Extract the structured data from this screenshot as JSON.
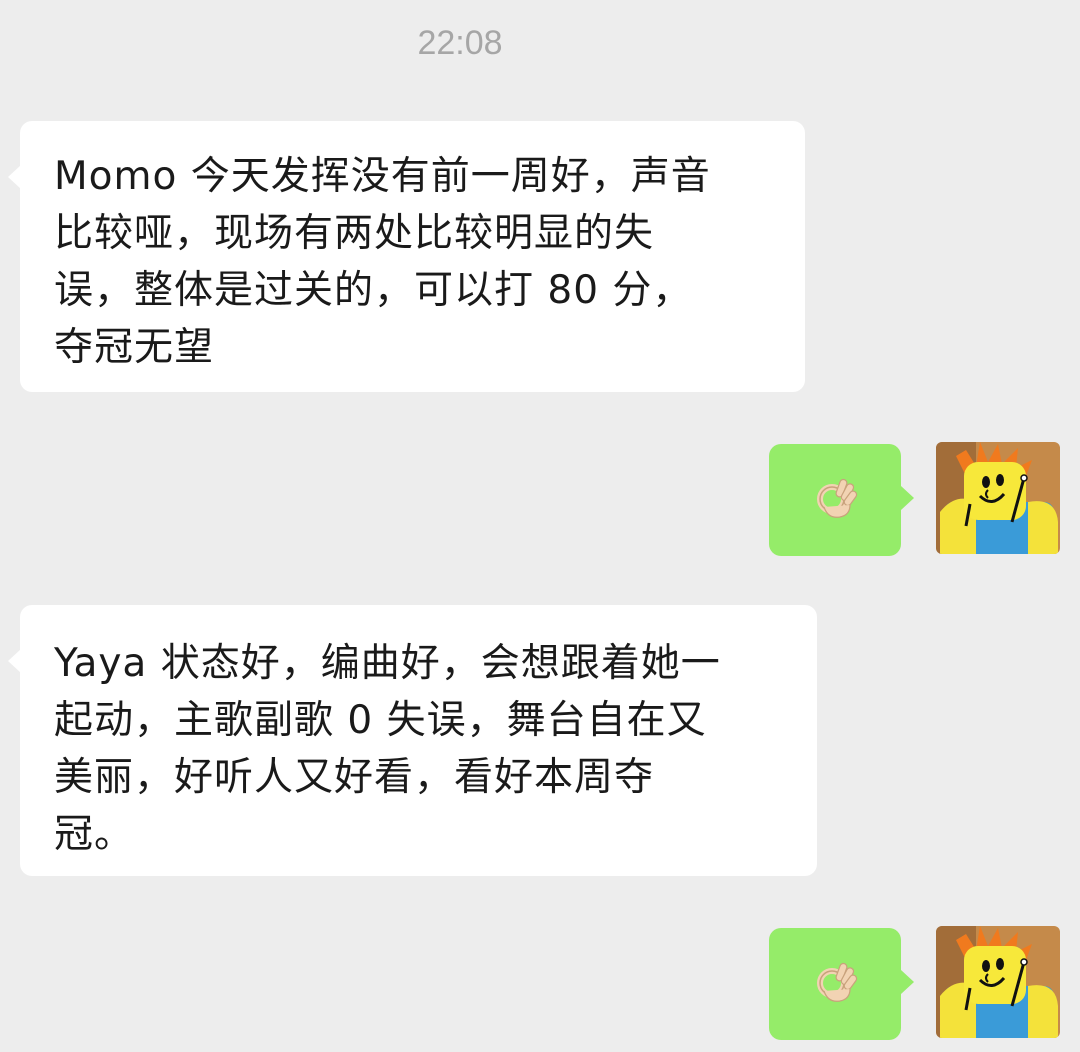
{
  "chat": {
    "timestamp": "22:08",
    "messages": [
      {
        "sender": "other",
        "lines": [
          "Momo 今天发挥没有前一周好，声音",
          "比较哑，现场有两处比较明显的失",
          "误，整体是过关的，可以打 80 分，",
          "夺冠无望"
        ]
      },
      {
        "sender": "self",
        "content": "ok-hand-emoji"
      },
      {
        "sender": "other",
        "lines": [
          "Yaya 状态好，编曲好，会想跟着她一",
          "起动，主歌副歌 0 失误，舞台自在又",
          "美丽，好听人又好看，看好本周夺",
          "冠。"
        ]
      },
      {
        "sender": "self",
        "content": "ok-hand-emoji"
      }
    ]
  },
  "colors": {
    "background": "#ededed",
    "incoming_bubble": "#ffffff",
    "outgoing_bubble": "#95ec69",
    "timestamp_text": "#a6a6a6",
    "avatar_hair": "#f07a1e",
    "avatar_face": "#f7e83a",
    "avatar_shirt": "#3a9bd8"
  }
}
